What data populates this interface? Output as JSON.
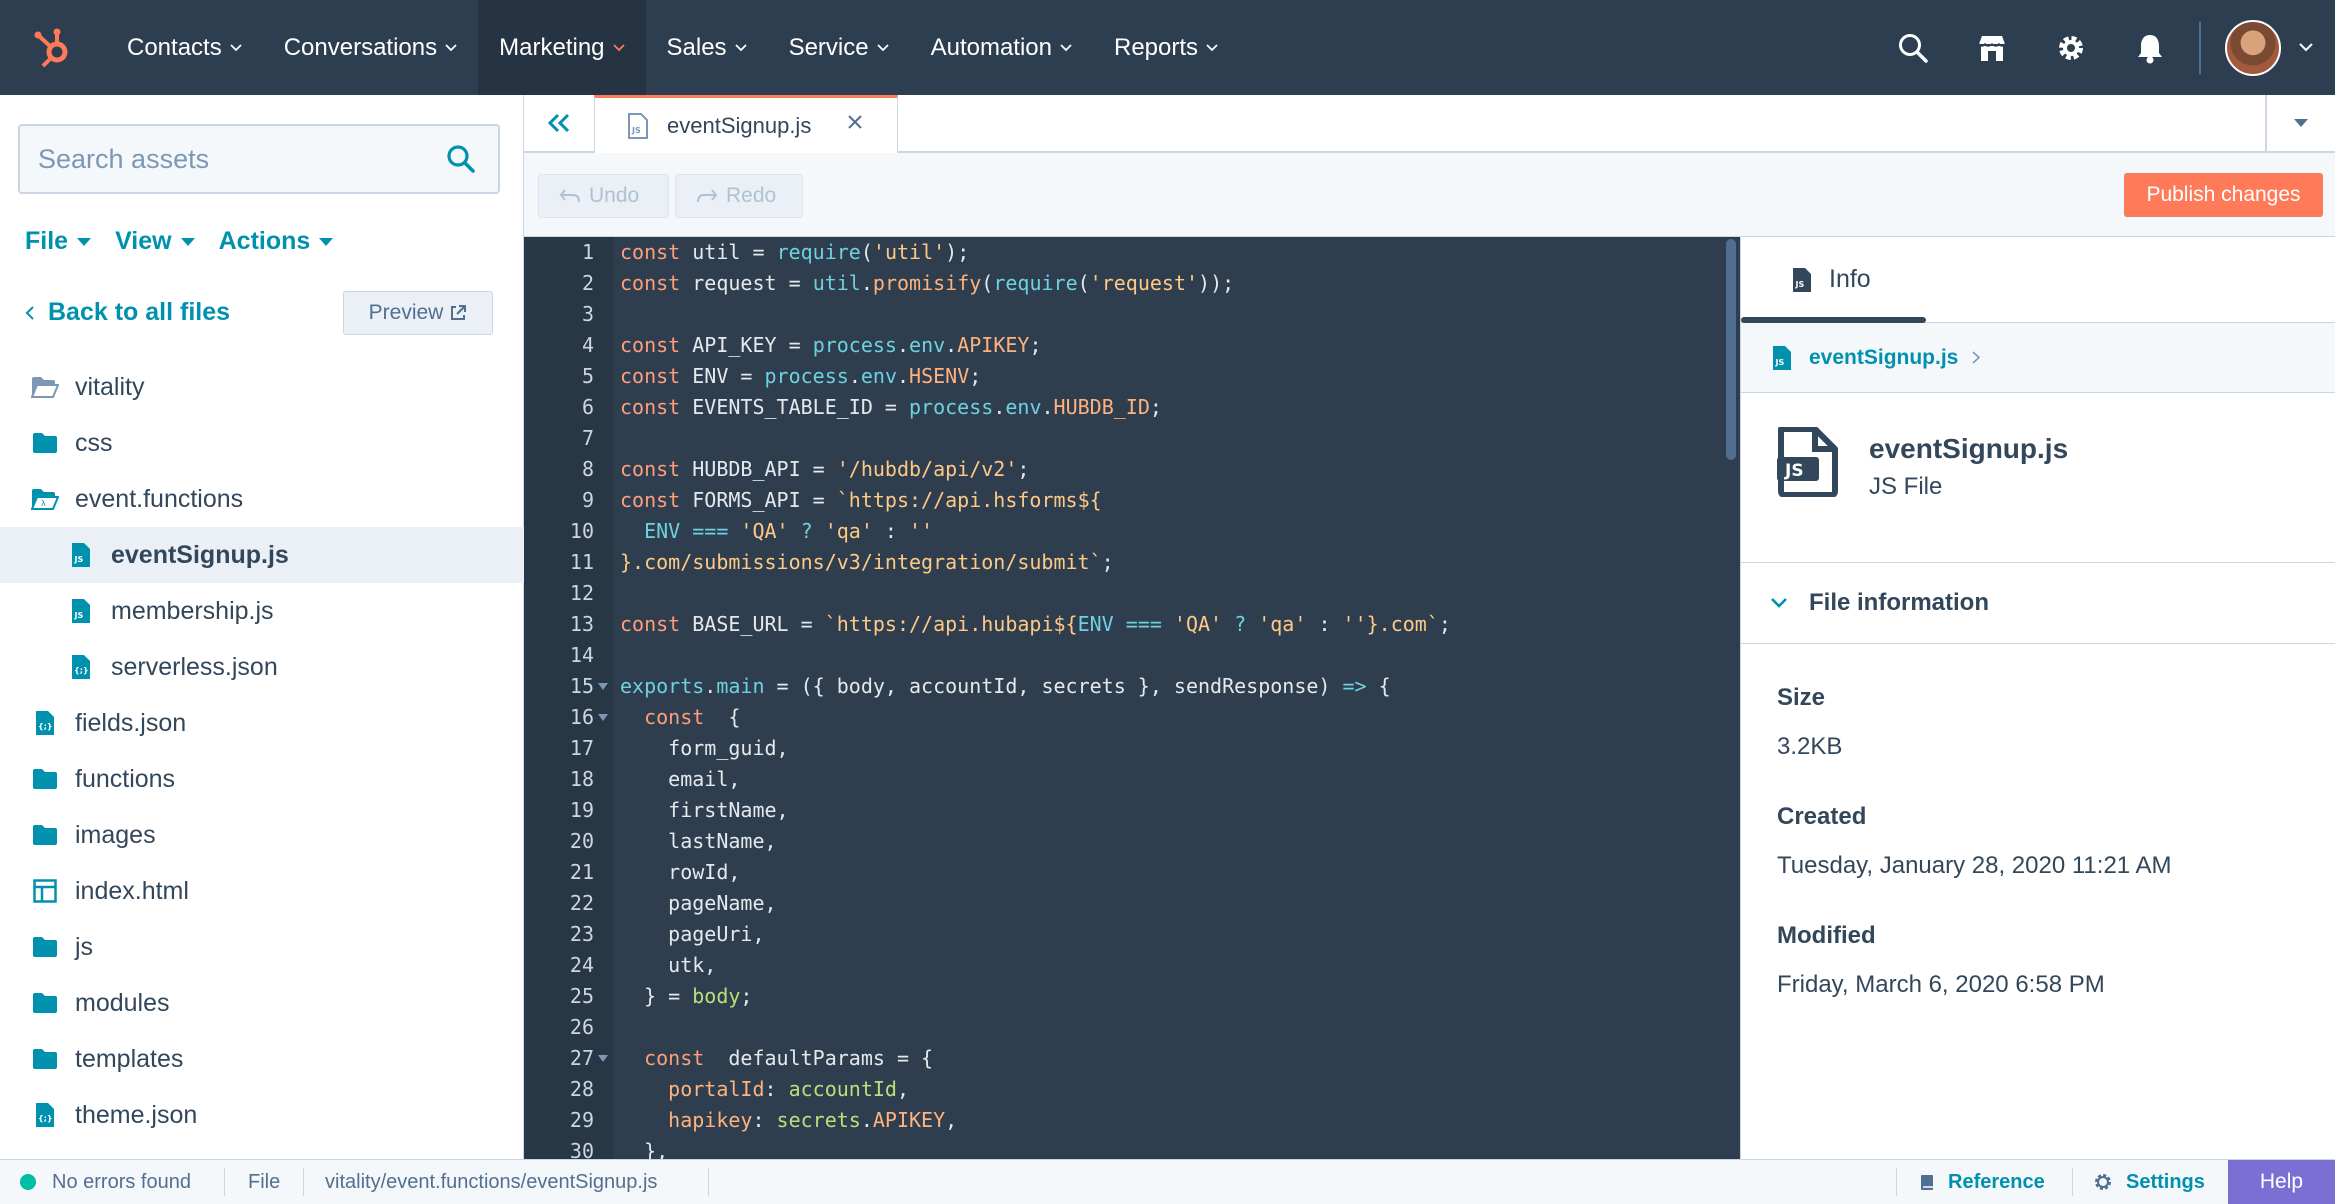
{
  "nav": {
    "items": [
      {
        "label": "Contacts",
        "active": false
      },
      {
        "label": "Conversations",
        "active": false
      },
      {
        "label": "Marketing",
        "active": true
      },
      {
        "label": "Sales",
        "active": false
      },
      {
        "label": "Service",
        "active": false
      },
      {
        "label": "Automation",
        "active": false
      },
      {
        "label": "Reports",
        "active": false
      }
    ],
    "icons": [
      "search-icon",
      "marketplace-icon",
      "settings-gear-icon",
      "notifications-bell-icon"
    ]
  },
  "sidebar": {
    "search_placeholder": "Search assets",
    "menus": [
      "File",
      "View",
      "Actions"
    ],
    "back_label": "Back to all files",
    "preview_label": "Preview",
    "tree": [
      {
        "label": "vitality",
        "icon": "folder-open-icon",
        "level": 0,
        "selected": false
      },
      {
        "label": "css",
        "icon": "folder-icon",
        "level": 0,
        "selected": false
      },
      {
        "label": "event.functions",
        "icon": "functions-folder-icon",
        "level": 0,
        "selected": false
      },
      {
        "label": "eventSignup.js",
        "icon": "js-file-icon",
        "level": 1,
        "selected": true
      },
      {
        "label": "membership.js",
        "icon": "js-file-icon",
        "level": 1,
        "selected": false
      },
      {
        "label": "serverless.json",
        "icon": "json-file-icon",
        "level": 1,
        "selected": false
      },
      {
        "label": "fields.json",
        "icon": "json-file-icon",
        "level": 0,
        "selected": false
      },
      {
        "label": "functions",
        "icon": "folder-icon",
        "level": 0,
        "selected": false
      },
      {
        "label": "images",
        "icon": "folder-icon",
        "level": 0,
        "selected": false
      },
      {
        "label": "index.html",
        "icon": "template-file-icon",
        "level": 0,
        "selected": false
      },
      {
        "label": "js",
        "icon": "folder-icon",
        "level": 0,
        "selected": false
      },
      {
        "label": "modules",
        "icon": "folder-icon",
        "level": 0,
        "selected": false
      },
      {
        "label": "templates",
        "icon": "folder-icon",
        "level": 0,
        "selected": false
      },
      {
        "label": "theme.json",
        "icon": "json-file-icon",
        "level": 0,
        "selected": false
      }
    ]
  },
  "tab": {
    "label": "eventSignup.js"
  },
  "toolbar": {
    "undo": "Undo",
    "redo": "Redo",
    "publish": "Publish changes"
  },
  "code": [
    {
      "n": "1",
      "fold": false,
      "t": [
        [
          "k",
          "const"
        ],
        [
          "",
          "util = "
        ],
        [
          "f",
          "require"
        ],
        [
          "",
          "("
        ],
        [
          "s",
          "'util'"
        ],
        [
          "",
          ");"
        ]
      ]
    },
    {
      "n": "2",
      "fold": false,
      "t": [
        [
          "k",
          "const"
        ],
        [
          "",
          "request = "
        ],
        [
          "f",
          "util"
        ],
        [
          "",
          "."
        ],
        [
          "p",
          "promisify"
        ],
        [
          "",
          "("
        ],
        [
          "f",
          "require"
        ],
        [
          "",
          "("
        ],
        [
          "s",
          "'request'"
        ],
        [
          "",
          "));"
        ]
      ]
    },
    {
      "n": "3",
      "fold": false,
      "t": []
    },
    {
      "n": "4",
      "fold": false,
      "t": [
        [
          "k",
          "const"
        ],
        [
          "",
          "API_KEY = "
        ],
        [
          "f",
          "process"
        ],
        [
          "",
          "."
        ],
        [
          "f",
          "env"
        ],
        [
          "",
          "."
        ],
        [
          "p",
          "APIKEY"
        ],
        [
          "",
          ";"
        ]
      ]
    },
    {
      "n": "5",
      "fold": false,
      "t": [
        [
          "k",
          "const"
        ],
        [
          "",
          "ENV = "
        ],
        [
          "f",
          "process"
        ],
        [
          "",
          "."
        ],
        [
          "f",
          "env"
        ],
        [
          "",
          "."
        ],
        [
          "p",
          "HSENV"
        ],
        [
          "",
          ";"
        ]
      ]
    },
    {
      "n": "6",
      "fold": false,
      "t": [
        [
          "k",
          "const"
        ],
        [
          "",
          "EVENTS_TABLE_ID = "
        ],
        [
          "f",
          "process"
        ],
        [
          "",
          "."
        ],
        [
          "f",
          "env"
        ],
        [
          "",
          "."
        ],
        [
          "p",
          "HUBDB_ID"
        ],
        [
          "",
          ";"
        ]
      ]
    },
    {
      "n": "7",
      "fold": false,
      "t": []
    },
    {
      "n": "8",
      "fold": false,
      "t": [
        [
          "k",
          "const"
        ],
        [
          "",
          "HUBDB_API = "
        ],
        [
          "s",
          "'/hubdb/api/v2'"
        ],
        [
          "",
          ";"
        ]
      ]
    },
    {
      "n": "9",
      "fold": false,
      "t": [
        [
          "k",
          "const"
        ],
        [
          "",
          "FORMS_API = "
        ],
        [
          "s",
          "`https://api.hsforms${"
        ]
      ]
    },
    {
      "n": "10",
      "fold": false,
      "t": [
        [
          "f",
          "  ENV "
        ],
        [
          "o",
          "==="
        ],
        [
          "s",
          " 'QA' "
        ],
        [
          "o",
          "?"
        ],
        [
          "s",
          " 'qa' "
        ],
        [
          "",
          ": "
        ],
        [
          "s",
          "''"
        ]
      ]
    },
    {
      "n": "11",
      "fold": false,
      "t": [
        [
          "s",
          "}.com/submissions/v3/integration/submit`"
        ],
        [
          "",
          ";"
        ]
      ]
    },
    {
      "n": "12",
      "fold": false,
      "t": []
    },
    {
      "n": "13",
      "fold": false,
      "t": [
        [
          "k",
          "const"
        ],
        [
          "",
          "BASE_URL = "
        ],
        [
          "s",
          "`https://api.hubapi${"
        ],
        [
          "f",
          "ENV "
        ],
        [
          "o",
          "==="
        ],
        [
          "s",
          " 'QA' "
        ],
        [
          "o",
          "?"
        ],
        [
          "s",
          " 'qa' "
        ],
        [
          "",
          ": "
        ],
        [
          "s",
          "''"
        ],
        [
          "s",
          "}.com`"
        ],
        [
          "",
          ";"
        ]
      ]
    },
    {
      "n": "14",
      "fold": false,
      "t": []
    },
    {
      "n": "15",
      "fold": true,
      "t": [
        [
          "f",
          "exports"
        ],
        [
          "",
          "."
        ],
        [
          "f",
          "main"
        ],
        [
          "",
          " = ({ body, accountId, secrets }, sendResponse) "
        ],
        [
          "o",
          "=>"
        ],
        [
          "",
          " {"
        ]
      ]
    },
    {
      "n": "16",
      "fold": true,
      "t": [
        [
          "k",
          "  const"
        ],
        [
          "",
          " {"
        ]
      ]
    },
    {
      "n": "17",
      "fold": false,
      "t": [
        [
          "",
          "    form_guid,"
        ]
      ]
    },
    {
      "n": "18",
      "fold": false,
      "t": [
        [
          "",
          "    email,"
        ]
      ]
    },
    {
      "n": "19",
      "fold": false,
      "t": [
        [
          "",
          "    firstName,"
        ]
      ]
    },
    {
      "n": "20",
      "fold": false,
      "t": [
        [
          "",
          "    lastName,"
        ]
      ]
    },
    {
      "n": "21",
      "fold": false,
      "t": [
        [
          "",
          "    rowId,"
        ]
      ]
    },
    {
      "n": "22",
      "fold": false,
      "t": [
        [
          "",
          "    pageName,"
        ]
      ]
    },
    {
      "n": "23",
      "fold": false,
      "t": [
        [
          "",
          "    pageUri,"
        ]
      ]
    },
    {
      "n": "24",
      "fold": false,
      "t": [
        [
          "",
          "    utk,"
        ]
      ]
    },
    {
      "n": "25",
      "fold": false,
      "t": [
        [
          "",
          "  } = "
        ],
        [
          "g",
          "body"
        ],
        [
          "",
          ";"
        ]
      ]
    },
    {
      "n": "26",
      "fold": false,
      "t": []
    },
    {
      "n": "27",
      "fold": true,
      "t": [
        [
          "k",
          "  const"
        ],
        [
          "",
          " defaultParams = {"
        ]
      ]
    },
    {
      "n": "28",
      "fold": false,
      "t": [
        [
          "p",
          "    portalId"
        ],
        [
          "",
          ": "
        ],
        [
          "g",
          "accountId"
        ],
        [
          "",
          ","
        ]
      ]
    },
    {
      "n": "29",
      "fold": false,
      "t": [
        [
          "p",
          "    hapikey"
        ],
        [
          "",
          ": "
        ],
        [
          "g",
          "secrets"
        ],
        [
          "",
          "."
        ],
        [
          "p",
          "APIKEY"
        ],
        [
          "",
          ","
        ]
      ]
    },
    {
      "n": "30",
      "fold": false,
      "t": [
        [
          "",
          "  },"
        ]
      ]
    }
  ],
  "info": {
    "tab_label": "Info",
    "crumb": "eventSignup.js",
    "file_name": "eventSignup.js",
    "file_type": "JS File",
    "section_title": "File information",
    "fields": [
      {
        "label": "Size",
        "value": "3.2KB"
      },
      {
        "label": "Created",
        "value": "Tuesday, January 28, 2020 11:21 AM"
      },
      {
        "label": "Modified",
        "value": "Friday, March 6, 2020 6:58 PM"
      }
    ]
  },
  "status": {
    "errors": "No errors found",
    "file": "File",
    "path": "vitality/event.functions/eventSignup.js",
    "reference": "Reference",
    "settings": "Settings",
    "help": "Help"
  },
  "colors": {
    "accent": "#ff7a59",
    "nav_bg": "#2d3e50",
    "link": "#0091ae",
    "editor_bg": "#2f3e4e",
    "help_bg": "#7c6fd4",
    "ok": "#00bda5"
  }
}
